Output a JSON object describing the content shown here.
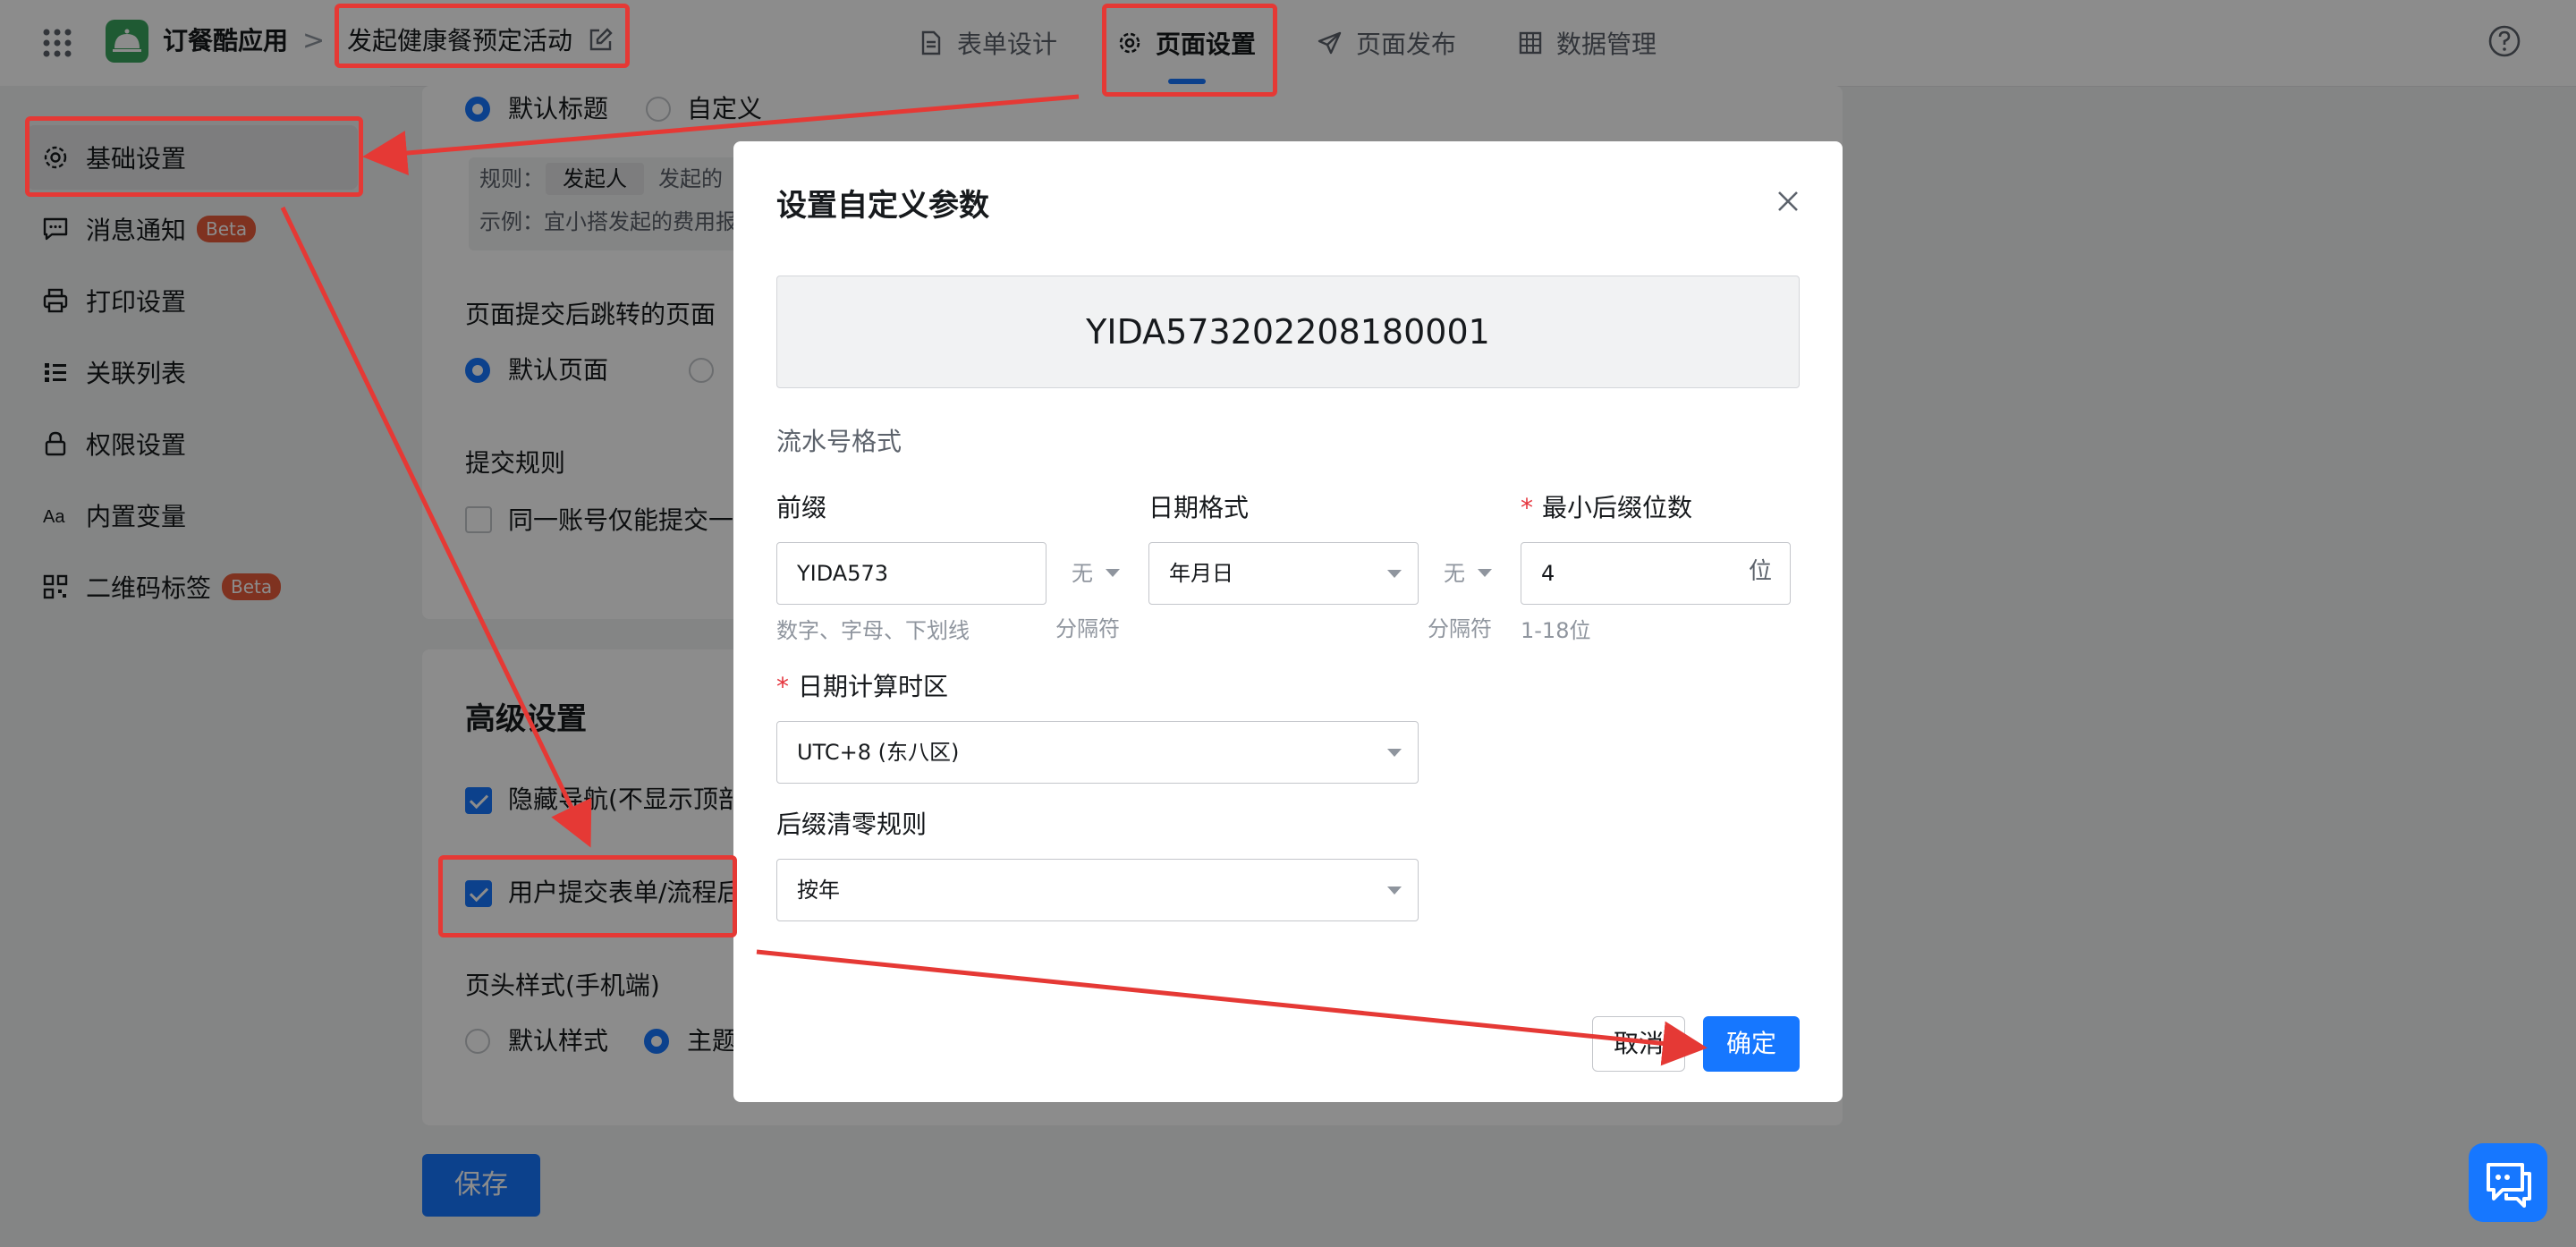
{
  "topbar": {
    "app_name": "订餐酷应用",
    "breadcrumb_separator": ">",
    "page_name": "发起健康餐预定活动",
    "tabs": [
      {
        "label": "表单设计",
        "icon": "document-icon"
      },
      {
        "label": "页面设置",
        "icon": "gear-icon",
        "active": true
      },
      {
        "label": "页面发布",
        "icon": "send-icon"
      },
      {
        "label": "数据管理",
        "icon": "table-grid-icon"
      }
    ]
  },
  "sidebar": {
    "items": [
      {
        "label": "基础设置",
        "icon": "gear-icon",
        "active": true
      },
      {
        "label": "消息通知",
        "icon": "message-icon",
        "badge": "Beta"
      },
      {
        "label": "打印设置",
        "icon": "printer-icon"
      },
      {
        "label": "关联列表",
        "icon": "list-icon"
      },
      {
        "label": "权限设置",
        "icon": "lock-icon"
      },
      {
        "label": "内置变量",
        "icon": "text-variable-icon"
      },
      {
        "label": "二维码标签",
        "icon": "qrcode-icon",
        "badge": "Beta"
      }
    ]
  },
  "background": {
    "title_options": [
      "默认标题",
      "自定义"
    ],
    "rule_label": "规则：",
    "rule_tag": "发起人",
    "rule_suffix": "发起的",
    "example_label": "示例：宜小搭发起的费用报",
    "redirect_title": "页面提交后跳转的页面",
    "redirect_option": "默认页面",
    "submit_rule_title": "提交规则",
    "submit_rule_option": "同一账号仅能提交一",
    "advanced_title": "高级设置",
    "hide_nav": "隐藏导航(不显示顶部",
    "after_submit": "用户提交表单/流程后",
    "header_style_title": "页头样式(手机端)",
    "header_style_options": [
      "默认样式",
      "主题"
    ],
    "save_label": "保存"
  },
  "modal": {
    "title": "设置自定义参数",
    "preview_value": "YIDA573202208180001",
    "section_label": "流水号格式",
    "prefix_label": "前缀",
    "prefix_value": "YIDA573",
    "prefix_hint": "数字、字母、下划线",
    "separator_value": "无",
    "separator_hint": "分隔符",
    "date_format_label": "日期格式",
    "date_format_value": "年月日",
    "min_digits_label": "最小后缀位数",
    "min_digits_value": "4",
    "min_digits_unit": "位",
    "min_digits_hint": "1-18位",
    "timezone_label": "日期计算时区",
    "timezone_value": "UTC+8 (东八区)",
    "reset_label": "后缀清零规则",
    "reset_value": "按年",
    "cancel_label": "取消",
    "ok_label": "确定"
  },
  "colors": {
    "accent": "#1677ff",
    "annotation": "#e53935",
    "beta_badge": "#e85b3b",
    "app_logo": "#3aa55d"
  }
}
